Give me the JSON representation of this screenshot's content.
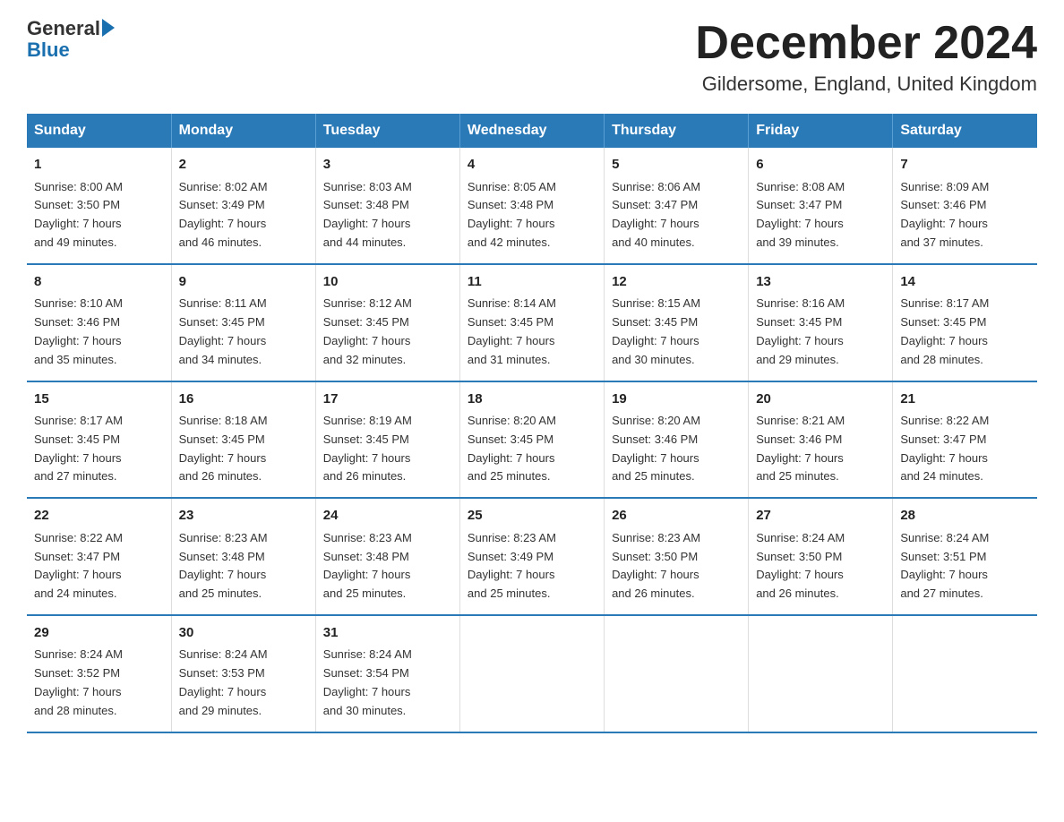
{
  "header": {
    "logo": {
      "general": "General",
      "blue": "Blue"
    },
    "title": "December 2024",
    "location": "Gildersome, England, United Kingdom"
  },
  "days_of_week": [
    "Sunday",
    "Monday",
    "Tuesday",
    "Wednesday",
    "Thursday",
    "Friday",
    "Saturday"
  ],
  "weeks": [
    [
      {
        "day": "1",
        "sunrise": "Sunrise: 8:00 AM",
        "sunset": "Sunset: 3:50 PM",
        "daylight": "Daylight: 7 hours",
        "minutes": "and 49 minutes."
      },
      {
        "day": "2",
        "sunrise": "Sunrise: 8:02 AM",
        "sunset": "Sunset: 3:49 PM",
        "daylight": "Daylight: 7 hours",
        "minutes": "and 46 minutes."
      },
      {
        "day": "3",
        "sunrise": "Sunrise: 8:03 AM",
        "sunset": "Sunset: 3:48 PM",
        "daylight": "Daylight: 7 hours",
        "minutes": "and 44 minutes."
      },
      {
        "day": "4",
        "sunrise": "Sunrise: 8:05 AM",
        "sunset": "Sunset: 3:48 PM",
        "daylight": "Daylight: 7 hours",
        "minutes": "and 42 minutes."
      },
      {
        "day": "5",
        "sunrise": "Sunrise: 8:06 AM",
        "sunset": "Sunset: 3:47 PM",
        "daylight": "Daylight: 7 hours",
        "minutes": "and 40 minutes."
      },
      {
        "day": "6",
        "sunrise": "Sunrise: 8:08 AM",
        "sunset": "Sunset: 3:47 PM",
        "daylight": "Daylight: 7 hours",
        "minutes": "and 39 minutes."
      },
      {
        "day": "7",
        "sunrise": "Sunrise: 8:09 AM",
        "sunset": "Sunset: 3:46 PM",
        "daylight": "Daylight: 7 hours",
        "minutes": "and 37 minutes."
      }
    ],
    [
      {
        "day": "8",
        "sunrise": "Sunrise: 8:10 AM",
        "sunset": "Sunset: 3:46 PM",
        "daylight": "Daylight: 7 hours",
        "minutes": "and 35 minutes."
      },
      {
        "day": "9",
        "sunrise": "Sunrise: 8:11 AM",
        "sunset": "Sunset: 3:45 PM",
        "daylight": "Daylight: 7 hours",
        "minutes": "and 34 minutes."
      },
      {
        "day": "10",
        "sunrise": "Sunrise: 8:12 AM",
        "sunset": "Sunset: 3:45 PM",
        "daylight": "Daylight: 7 hours",
        "minutes": "and 32 minutes."
      },
      {
        "day": "11",
        "sunrise": "Sunrise: 8:14 AM",
        "sunset": "Sunset: 3:45 PM",
        "daylight": "Daylight: 7 hours",
        "minutes": "and 31 minutes."
      },
      {
        "day": "12",
        "sunrise": "Sunrise: 8:15 AM",
        "sunset": "Sunset: 3:45 PM",
        "daylight": "Daylight: 7 hours",
        "minutes": "and 30 minutes."
      },
      {
        "day": "13",
        "sunrise": "Sunrise: 8:16 AM",
        "sunset": "Sunset: 3:45 PM",
        "daylight": "Daylight: 7 hours",
        "minutes": "and 29 minutes."
      },
      {
        "day": "14",
        "sunrise": "Sunrise: 8:17 AM",
        "sunset": "Sunset: 3:45 PM",
        "daylight": "Daylight: 7 hours",
        "minutes": "and 28 minutes."
      }
    ],
    [
      {
        "day": "15",
        "sunrise": "Sunrise: 8:17 AM",
        "sunset": "Sunset: 3:45 PM",
        "daylight": "Daylight: 7 hours",
        "minutes": "and 27 minutes."
      },
      {
        "day": "16",
        "sunrise": "Sunrise: 8:18 AM",
        "sunset": "Sunset: 3:45 PM",
        "daylight": "Daylight: 7 hours",
        "minutes": "and 26 minutes."
      },
      {
        "day": "17",
        "sunrise": "Sunrise: 8:19 AM",
        "sunset": "Sunset: 3:45 PM",
        "daylight": "Daylight: 7 hours",
        "minutes": "and 26 minutes."
      },
      {
        "day": "18",
        "sunrise": "Sunrise: 8:20 AM",
        "sunset": "Sunset: 3:45 PM",
        "daylight": "Daylight: 7 hours",
        "minutes": "and 25 minutes."
      },
      {
        "day": "19",
        "sunrise": "Sunrise: 8:20 AM",
        "sunset": "Sunset: 3:46 PM",
        "daylight": "Daylight: 7 hours",
        "minutes": "and 25 minutes."
      },
      {
        "day": "20",
        "sunrise": "Sunrise: 8:21 AM",
        "sunset": "Sunset: 3:46 PM",
        "daylight": "Daylight: 7 hours",
        "minutes": "and 25 minutes."
      },
      {
        "day": "21",
        "sunrise": "Sunrise: 8:22 AM",
        "sunset": "Sunset: 3:47 PM",
        "daylight": "Daylight: 7 hours",
        "minutes": "and 24 minutes."
      }
    ],
    [
      {
        "day": "22",
        "sunrise": "Sunrise: 8:22 AM",
        "sunset": "Sunset: 3:47 PM",
        "daylight": "Daylight: 7 hours",
        "minutes": "and 24 minutes."
      },
      {
        "day": "23",
        "sunrise": "Sunrise: 8:23 AM",
        "sunset": "Sunset: 3:48 PM",
        "daylight": "Daylight: 7 hours",
        "minutes": "and 25 minutes."
      },
      {
        "day": "24",
        "sunrise": "Sunrise: 8:23 AM",
        "sunset": "Sunset: 3:48 PM",
        "daylight": "Daylight: 7 hours",
        "minutes": "and 25 minutes."
      },
      {
        "day": "25",
        "sunrise": "Sunrise: 8:23 AM",
        "sunset": "Sunset: 3:49 PM",
        "daylight": "Daylight: 7 hours",
        "minutes": "and 25 minutes."
      },
      {
        "day": "26",
        "sunrise": "Sunrise: 8:23 AM",
        "sunset": "Sunset: 3:50 PM",
        "daylight": "Daylight: 7 hours",
        "minutes": "and 26 minutes."
      },
      {
        "day": "27",
        "sunrise": "Sunrise: 8:24 AM",
        "sunset": "Sunset: 3:50 PM",
        "daylight": "Daylight: 7 hours",
        "minutes": "and 26 minutes."
      },
      {
        "day": "28",
        "sunrise": "Sunrise: 8:24 AM",
        "sunset": "Sunset: 3:51 PM",
        "daylight": "Daylight: 7 hours",
        "minutes": "and 27 minutes."
      }
    ],
    [
      {
        "day": "29",
        "sunrise": "Sunrise: 8:24 AM",
        "sunset": "Sunset: 3:52 PM",
        "daylight": "Daylight: 7 hours",
        "minutes": "and 28 minutes."
      },
      {
        "day": "30",
        "sunrise": "Sunrise: 8:24 AM",
        "sunset": "Sunset: 3:53 PM",
        "daylight": "Daylight: 7 hours",
        "minutes": "and 29 minutes."
      },
      {
        "day": "31",
        "sunrise": "Sunrise: 8:24 AM",
        "sunset": "Sunset: 3:54 PM",
        "daylight": "Daylight: 7 hours",
        "minutes": "and 30 minutes."
      },
      null,
      null,
      null,
      null
    ]
  ]
}
